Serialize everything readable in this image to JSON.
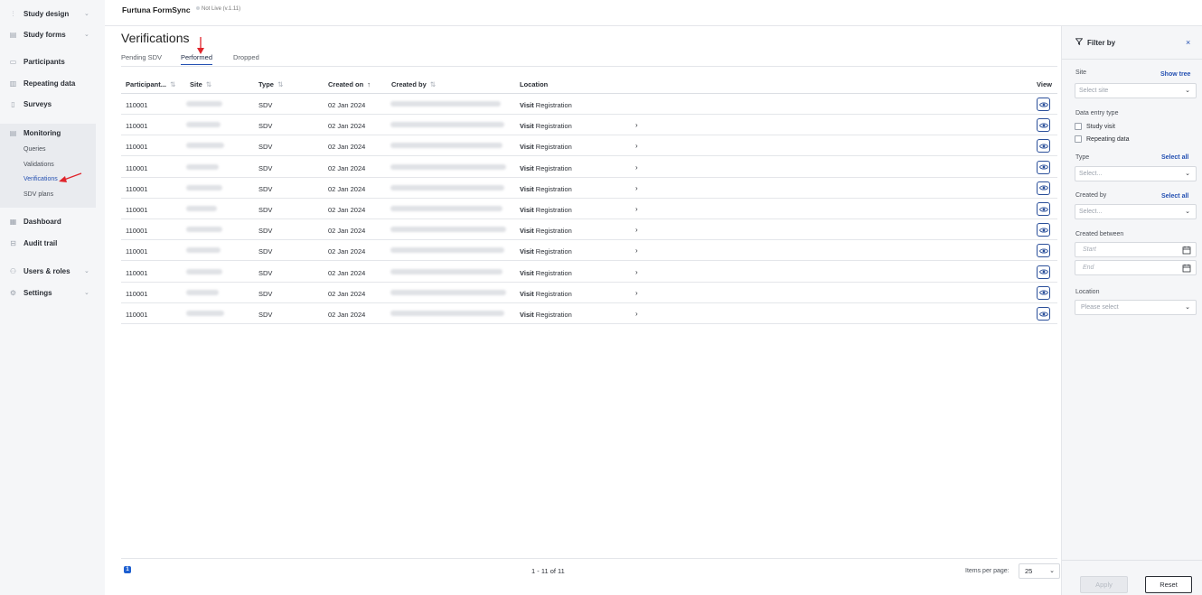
{
  "app": {
    "name": "Furtuna FormSync",
    "status": "Not Live (v.1.11)"
  },
  "sidebar": {
    "items": [
      {
        "label": "Study design",
        "icon": "study-design-icon",
        "chevron": "⌄"
      },
      {
        "label": "Study forms",
        "icon": "study-forms-icon",
        "chevron": "⌄"
      },
      {
        "label": "Participants",
        "icon": "participants-icon"
      },
      {
        "label": "Repeating data",
        "icon": "repeating-data-icon"
      },
      {
        "label": "Surveys",
        "icon": "surveys-icon"
      },
      {
        "label": "Monitoring",
        "icon": "monitoring-icon"
      },
      {
        "label": "Dashboard",
        "icon": "dashboard-icon"
      },
      {
        "label": "Audit trail",
        "icon": "audit-trail-icon"
      },
      {
        "label": "Users & roles",
        "icon": "users-roles-icon",
        "chevron": "⌄"
      },
      {
        "label": "Settings",
        "icon": "settings-icon",
        "chevron": "⌄"
      }
    ],
    "monitoring_sub": [
      {
        "label": "Queries"
      },
      {
        "label": "Validations"
      },
      {
        "label": "Verifications"
      },
      {
        "label": "SDV plans"
      }
    ]
  },
  "page": {
    "title": "Verifications",
    "tabs": [
      {
        "label": "Pending SDV"
      },
      {
        "label": "Performed"
      },
      {
        "label": "Dropped"
      }
    ]
  },
  "table": {
    "headers": {
      "participant": "Participant...",
      "site": "Site",
      "type": "Type",
      "created_on": "Created on",
      "created_by": "Created by",
      "location": "Location",
      "view": "View"
    },
    "sort_neutral": "⇅",
    "sort_up": "↑",
    "location_strong": "Visit",
    "location_rest": "Registration",
    "rows": [
      {
        "participant": "110001",
        "type": "SDV",
        "created_on": "02 Jan 2024",
        "has_chevron": false
      },
      {
        "participant": "110001",
        "type": "SDV",
        "created_on": "02 Jan 2024",
        "has_chevron": true
      },
      {
        "participant": "110001",
        "type": "SDV",
        "created_on": "02 Jan 2024",
        "has_chevron": true
      },
      {
        "participant": "110001",
        "type": "SDV",
        "created_on": "02 Jan 2024",
        "has_chevron": true
      },
      {
        "participant": "110001",
        "type": "SDV",
        "created_on": "02 Jan 2024",
        "has_chevron": true
      },
      {
        "participant": "110001",
        "type": "SDV",
        "created_on": "02 Jan 2024",
        "has_chevron": true
      },
      {
        "participant": "110001",
        "type": "SDV",
        "created_on": "02 Jan 2024",
        "has_chevron": true
      },
      {
        "participant": "110001",
        "type": "SDV",
        "created_on": "02 Jan 2024",
        "has_chevron": true
      },
      {
        "participant": "110001",
        "type": "SDV",
        "created_on": "02 Jan 2024",
        "has_chevron": true
      },
      {
        "participant": "110001",
        "type": "SDV",
        "created_on": "02 Jan 2024",
        "has_chevron": true
      },
      {
        "participant": "110001",
        "type": "SDV",
        "created_on": "02 Jan 2024",
        "has_chevron": true
      }
    ]
  },
  "footer": {
    "page_badge": "1",
    "range_text": "1 - 11 of 11",
    "items_per_page_label": "Items per page:",
    "items_per_page_value": "25"
  },
  "filter": {
    "title": "Filter by",
    "close": "×",
    "site_label": "Site",
    "site_link": "Show tree",
    "site_placeholder": "Select site",
    "data_entry_type_label": "Data entry type",
    "data_entry_options": [
      "Study visit",
      "Repeating data"
    ],
    "type_label": "Type",
    "type_link": "Select all",
    "type_placeholder": "Select...",
    "created_by_label": "Created by",
    "created_by_link": "Select all",
    "created_by_placeholder": "Select...",
    "created_between_label": "Created between",
    "start_placeholder": "Start",
    "end_placeholder": "End",
    "location_label": "Location",
    "location_placeholder": "Please select",
    "apply": "Apply",
    "reset": "Reset"
  },
  "colors": {
    "accent": "#2450b2",
    "annotation": "#e0242b"
  }
}
